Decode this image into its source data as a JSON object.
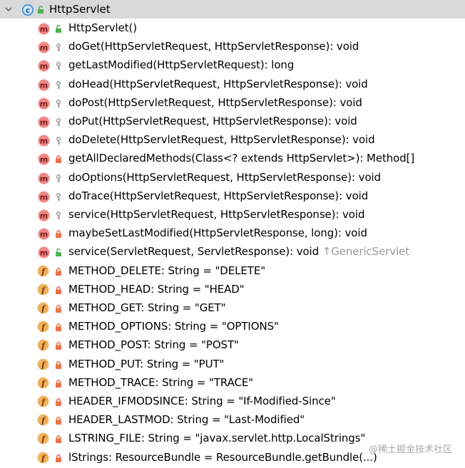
{
  "class": {
    "name": "HttpServlet"
  },
  "methods": [
    {
      "text": "HttpServlet()",
      "access": "public"
    },
    {
      "text": "doGet(HttpServletRequest, HttpServletResponse): void",
      "access": "protected"
    },
    {
      "text": "getLastModified(HttpServletRequest): long",
      "access": "protected"
    },
    {
      "text": "doHead(HttpServletRequest, HttpServletResponse): void",
      "access": "protected"
    },
    {
      "text": "doPost(HttpServletRequest, HttpServletResponse): void",
      "access": "protected"
    },
    {
      "text": "doPut(HttpServletRequest, HttpServletResponse): void",
      "access": "protected"
    },
    {
      "text": "doDelete(HttpServletRequest, HttpServletResponse): void",
      "access": "protected"
    },
    {
      "text": "getAllDeclaredMethods(Class<? extends HttpServlet>): Method[]",
      "access": "private"
    },
    {
      "text": "doOptions(HttpServletRequest, HttpServletResponse): void",
      "access": "protected"
    },
    {
      "text": "doTrace(HttpServletRequest, HttpServletResponse): void",
      "access": "protected"
    },
    {
      "text": "service(HttpServletRequest, HttpServletResponse): void",
      "access": "protected"
    },
    {
      "text": "maybeSetLastModified(HttpServletResponse, long): void",
      "access": "private"
    },
    {
      "text": "service(ServletRequest, ServletResponse): void",
      "access": "public",
      "inherited": "↑GenericServlet"
    }
  ],
  "fields": [
    {
      "text": "METHOD_DELETE: String = \"DELETE\""
    },
    {
      "text": "METHOD_HEAD: String = \"HEAD\""
    },
    {
      "text": "METHOD_GET: String = \"GET\""
    },
    {
      "text": "METHOD_OPTIONS: String = \"OPTIONS\""
    },
    {
      "text": "METHOD_POST: String = \"POST\""
    },
    {
      "text": "METHOD_PUT: String = \"PUT\""
    },
    {
      "text": "METHOD_TRACE: String = \"TRACE\""
    },
    {
      "text": "HEADER_IFMODSINCE: String = \"If-Modified-Since\""
    },
    {
      "text": "HEADER_LASTMOD: String = \"Last-Modified\""
    },
    {
      "text": "LSTRING_FILE: String = \"javax.servlet.http.LocalStrings\""
    },
    {
      "text": "lStrings: ResourceBundle = ResourceBundle.getBundle(...)"
    }
  ],
  "watermark": "@稀土掘金技术社区",
  "colors": {
    "header_bg": "#d9d9d9",
    "method_icon": "#f08787",
    "field_icon": "#f3b05a",
    "public_green": "#4caf50",
    "private_lock": "#e8734a",
    "inherited_gray": "#9a9a9a"
  }
}
